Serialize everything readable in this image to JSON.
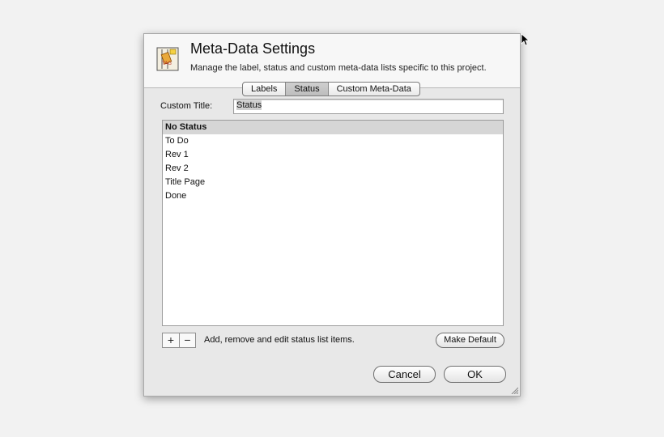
{
  "dialog": {
    "title": "Meta-Data Settings",
    "subtitle": "Manage the label, status and custom meta-data lists specific to this project.",
    "icon": "meta-data-tag-icon"
  },
  "tabs": [
    {
      "label": "Labels",
      "active": false
    },
    {
      "label": "Status",
      "active": true
    },
    {
      "label": "Custom Meta-Data",
      "active": false
    }
  ],
  "custom_title": {
    "label": "Custom Title:",
    "value": "Status"
  },
  "status_list": {
    "items": [
      "No Status",
      "To Do",
      "Rev 1",
      "Rev 2",
      "Title Page",
      "Done"
    ],
    "selected_index": 0
  },
  "list_controls": {
    "add_label": "+",
    "remove_label": "−",
    "hint": "Add, remove and edit status list items.",
    "make_default_label": "Make Default"
  },
  "buttons": {
    "cancel_label": "Cancel",
    "ok_label": "OK"
  },
  "colors": {
    "selected_row": "#d6d6d6",
    "dialog_bg": "#e8e8e8",
    "header_bg": "#f7f7f7"
  }
}
